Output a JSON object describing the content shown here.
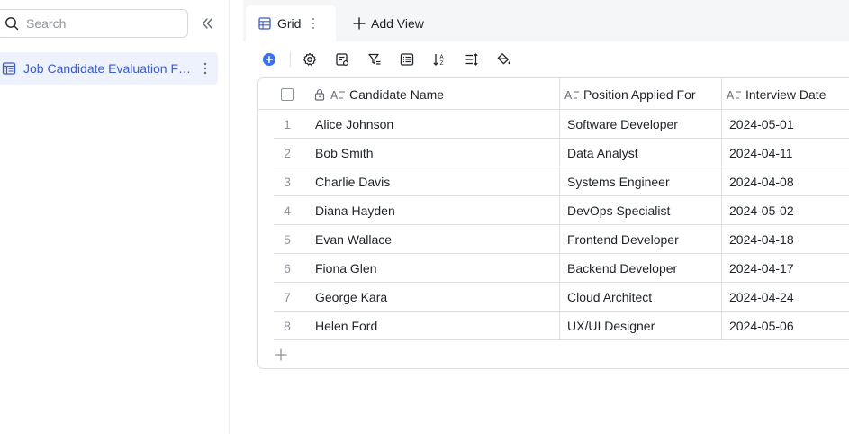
{
  "sidebar": {
    "search_placeholder": "Search",
    "tables": [
      {
        "label": "Job Candidate Evaluation Form"
      }
    ]
  },
  "views": {
    "active_tab": {
      "label": "Grid"
    },
    "add_view_label": "Add View"
  },
  "toolbar": {
    "icons": [
      "add-record-icon",
      "settings-icon",
      "field-list-icon",
      "filter-icon",
      "group-icon",
      "sort-icon",
      "row-height-icon",
      "fill-color-icon"
    ],
    "accent_color": "#3b6ff5"
  },
  "grid": {
    "columns": [
      {
        "name": "Candidate Name",
        "primary": true
      },
      {
        "name": "Position Applied For"
      },
      {
        "name": "Interview Date"
      }
    ],
    "rows": [
      {
        "index": "1",
        "name": "Alice Johnson",
        "position": "Software Developer",
        "date": "2024-05-01"
      },
      {
        "index": "2",
        "name": "Bob Smith",
        "position": "Data Analyst",
        "date": "2024-04-11"
      },
      {
        "index": "3",
        "name": "Charlie Davis",
        "position": "Systems Engineer",
        "date": "2024-04-08"
      },
      {
        "index": "4",
        "name": "Diana Hayden",
        "position": "DevOps Specialist",
        "date": "2024-05-02"
      },
      {
        "index": "5",
        "name": "Evan Wallace",
        "position": "Frontend Developer",
        "date": "2024-04-18"
      },
      {
        "index": "6",
        "name": "Fiona Glen",
        "position": "Backend Developer",
        "date": "2024-04-17"
      },
      {
        "index": "7",
        "name": "George Kara",
        "position": "Cloud Architect",
        "date": "2024-04-24"
      },
      {
        "index": "8",
        "name": "Helen Ford",
        "position": "UX/UI Designer",
        "date": "2024-05-06"
      }
    ]
  }
}
